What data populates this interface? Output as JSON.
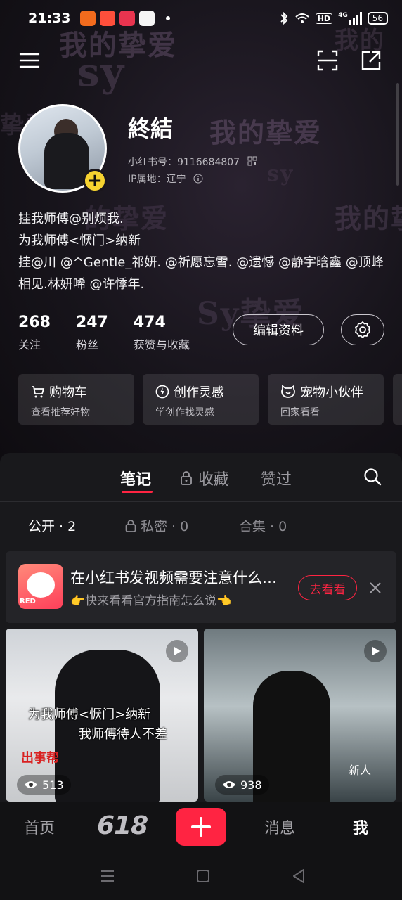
{
  "status_bar": {
    "time": "21:33",
    "hd": "HD",
    "signal": "4G",
    "battery": "56"
  },
  "profile": {
    "username": "終結",
    "id_line": "小红书号：9116684807",
    "ip_line": "IP属地：辽宁",
    "bio": [
      "挂我师傅@别烦我.",
      "为我师傅<恹门>纳新",
      "挂@川 @^Gentle_祁妍. @祈愿忘雪. @遗憾 @静宇晗鑫 @顶峰相见.林妍唏 @许悸年."
    ],
    "stats": [
      {
        "num": "268",
        "label": "关注"
      },
      {
        "num": "247",
        "label": "粉丝"
      },
      {
        "num": "474",
        "label": "获赞与收藏"
      }
    ],
    "edit_label": "编辑资料"
  },
  "cards": [
    {
      "title": "购物车",
      "sub": "查看推荐好物"
    },
    {
      "title": "创作灵感",
      "sub": "学创作找灵感"
    },
    {
      "title": "宠物小伙伴",
      "sub": "回家看看"
    }
  ],
  "tabs": {
    "notes": "笔记",
    "collect": "收藏",
    "liked": "赞过"
  },
  "subtabs": {
    "public": "公开 · 2",
    "private": "私密 · 0",
    "collection": "合集 · 0"
  },
  "notice": {
    "title": "在小红书发视频需要注意什么…",
    "sub": "👉快来看看官方指南怎么说👈",
    "button": "去看看",
    "thumb_label": "RED"
  },
  "posts": [
    {
      "caption1": "为我师傅<恹门>纳新",
      "caption2": "我师傅待人不差",
      "sticker": "出事帮",
      "views": "513"
    },
    {
      "views": "938",
      "small_text": "新人"
    }
  ],
  "bottom_nav": {
    "home": "首页",
    "promo": "618",
    "messages": "消息",
    "me": "我"
  },
  "colors": {
    "accent": "#ff2442",
    "badge": "#f6d330",
    "bg": "#19191c"
  }
}
